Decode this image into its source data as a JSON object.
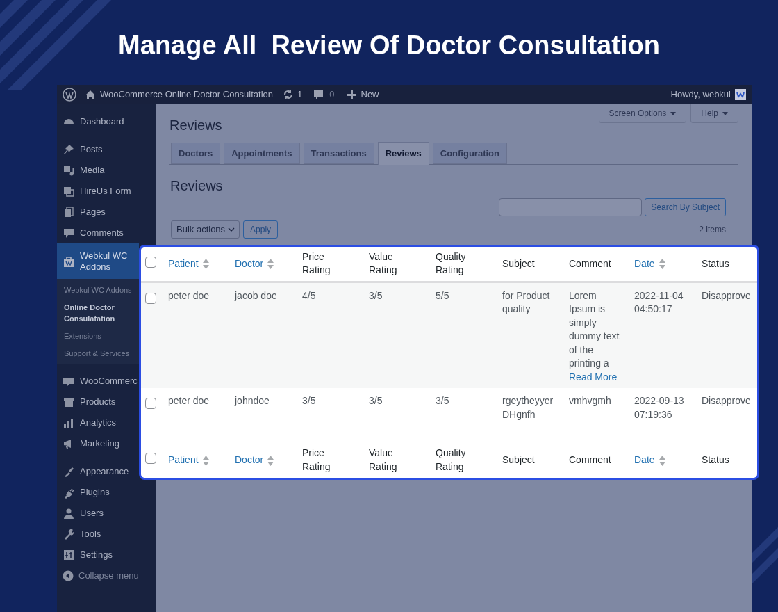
{
  "headline": "Manage All  Review Of Doctor Consultation",
  "admin_bar": {
    "site_title": "WooCommerce Online Doctor Consultation",
    "updates": "1",
    "comments": "0",
    "new": "New",
    "greeting": "Howdy, webkul"
  },
  "sidebar": {
    "groups": [
      {
        "items": [
          {
            "label": "Dashboard",
            "selected": false
          }
        ]
      },
      {
        "items": [
          {
            "label": "Posts",
            "selected": false
          },
          {
            "label": "Media",
            "selected": false
          },
          {
            "label": "HireUs Form",
            "selected": false
          },
          {
            "label": "Pages",
            "selected": false
          },
          {
            "label": "Comments",
            "selected": false
          },
          {
            "label": "Webkul WC Addons",
            "selected": true,
            "children": [
              {
                "label": "Webkul WC Addons",
                "selected": false
              },
              {
                "label": "Online Doctor Consulatation",
                "selected": true
              },
              {
                "label": "Extensions",
                "selected": false
              },
              {
                "label": "Support & Services",
                "selected": false
              }
            ]
          }
        ]
      },
      {
        "items": [
          {
            "label": "WooCommerc",
            "selected": false
          },
          {
            "label": "Products",
            "selected": false
          },
          {
            "label": "Analytics",
            "selected": false
          },
          {
            "label": "Marketing",
            "selected": false
          }
        ]
      },
      {
        "items": [
          {
            "label": "Appearance",
            "selected": false
          },
          {
            "label": "Plugins",
            "selected": false
          },
          {
            "label": "Users",
            "selected": false
          },
          {
            "label": "Tools",
            "selected": false
          },
          {
            "label": "Settings",
            "selected": false
          }
        ]
      }
    ],
    "collapse": "Collapse menu"
  },
  "screen_options": "Screen Options",
  "help": "Help",
  "page_title": "Reviews",
  "tabs": [
    {
      "label": "Doctors",
      "selected": false
    },
    {
      "label": "Appointments",
      "selected": false
    },
    {
      "label": "Transactions",
      "selected": false
    },
    {
      "label": "Reviews",
      "selected": true
    },
    {
      "label": "Configuration",
      "selected": false
    }
  ],
  "section_title": "Reviews",
  "search": {
    "button": "Search By Subject"
  },
  "bulk_actions": "Bulk actions",
  "apply": "Apply",
  "items_count": "2 items",
  "table": {
    "header_checked": false,
    "footer_checked": false,
    "columns": [
      {
        "label": "Patient",
        "sortable": true
      },
      {
        "label": "Doctor",
        "sortable": true
      },
      {
        "label": "Price Rating",
        "sortable": false
      },
      {
        "label": "Value Rating",
        "sortable": false
      },
      {
        "label": "Quality Rating",
        "sortable": false
      },
      {
        "label": "Subject",
        "sortable": false
      },
      {
        "label": "Comment",
        "sortable": false
      },
      {
        "label": "Date",
        "sortable": true
      },
      {
        "label": "Status",
        "sortable": false
      }
    ],
    "rows": [
      {
        "checked": false,
        "patient": "peter doe",
        "doctor": "jacob doe",
        "price_rating": "4/5",
        "value_rating": "3/5",
        "quality_rating": "5/5",
        "subject": "for Product quality",
        "comment": "Lorem Ipsum is simply dummy text of the printing a",
        "comment_link": "Read More",
        "date": "2022-11-04 04:50:17",
        "status": "Disapprove"
      },
      {
        "checked": false,
        "patient": "peter doe",
        "doctor": "johndoe",
        "price_rating": "3/5",
        "value_rating": "3/5",
        "quality_rating": "3/5",
        "subject": "rgeytheyyer DHgnfh",
        "comment": "vmhvgmh",
        "date": "2022-09-13 07:19:36",
        "status": "Disapprove"
      }
    ],
    "footer_columns": [
      {
        "label": "Patient",
        "sortable": true
      },
      {
        "label": "Doctor",
        "sortable": true
      },
      {
        "label": "Price Rating",
        "sortable": false
      },
      {
        "label": "Value Rating",
        "sortable": false
      },
      {
        "label": "Quality Rating",
        "sortable": false
      },
      {
        "label": "Subject",
        "sortable": false
      },
      {
        "label": "Comment",
        "sortable": false
      },
      {
        "label": "Date",
        "sortable": true
      },
      {
        "label": "Status",
        "sortable": false
      }
    ]
  }
}
